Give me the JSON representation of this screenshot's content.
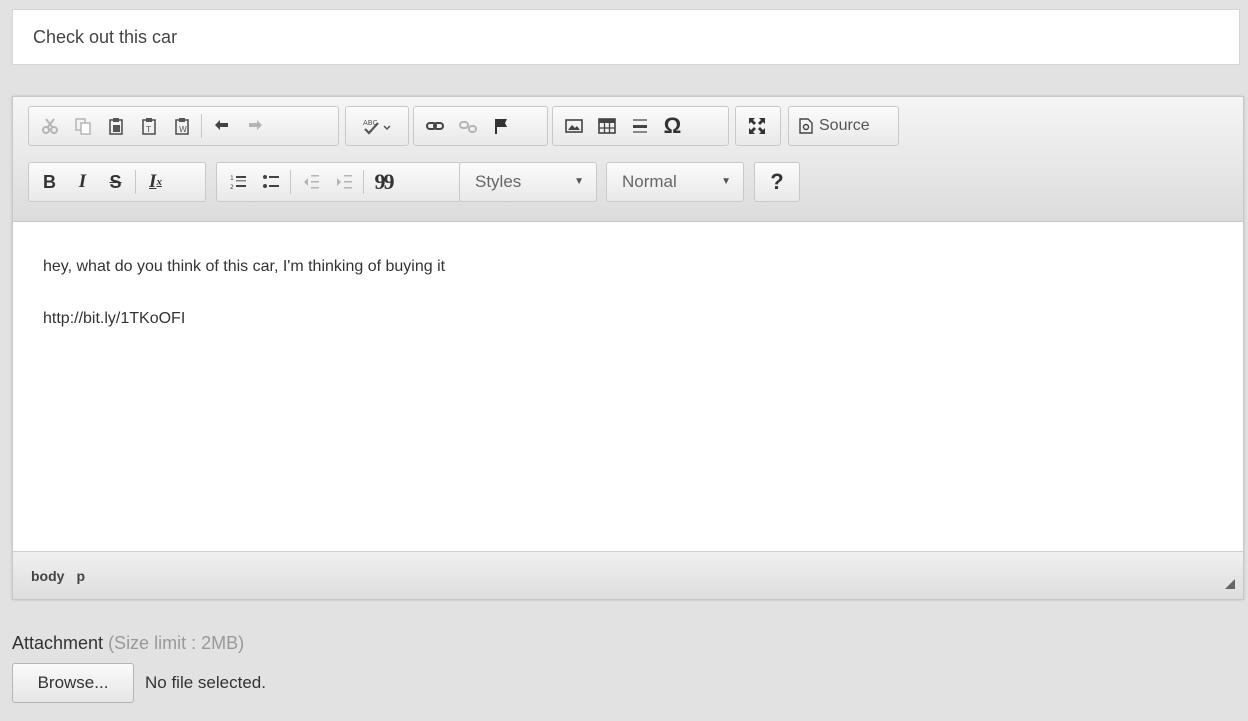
{
  "subject": {
    "value": "Check out this car"
  },
  "toolbar": {
    "row1": {
      "clipboard": [
        "cut-icon",
        "copy-icon",
        "paste-icon",
        "paste-text-icon",
        "paste-word-icon"
      ],
      "history": [
        "undo-icon",
        "redo-icon"
      ],
      "spellcheck_icon": "spellcheck-icon",
      "links": [
        "link-icon",
        "unlink-icon",
        "anchor-icon"
      ],
      "insert": [
        "image-icon",
        "table-icon",
        "horizontal-rule-icon",
        "special-char-icon"
      ],
      "special_char_glyph": "Ω",
      "maximize_icon": "maximize-icon",
      "source_label": "Source"
    },
    "row2": {
      "bold": "B",
      "italic": "I",
      "strike": "S",
      "remove_format": "I",
      "remove_format_sub": "x",
      "blockquote": "99",
      "styles_label": "Styles",
      "format_label": "Normal",
      "help": "?"
    }
  },
  "content": {
    "paragraphs": [
      "hey, what do you think of this car, I'm thinking of buying it",
      "http://bit.ly/1TKoOFI"
    ]
  },
  "statusbar": {
    "path": [
      "body",
      "p"
    ]
  },
  "attachment": {
    "label": "Attachment",
    "hint": "(Size limit : 2MB)",
    "browse_label": "Browse...",
    "no_file": "No file selected."
  }
}
